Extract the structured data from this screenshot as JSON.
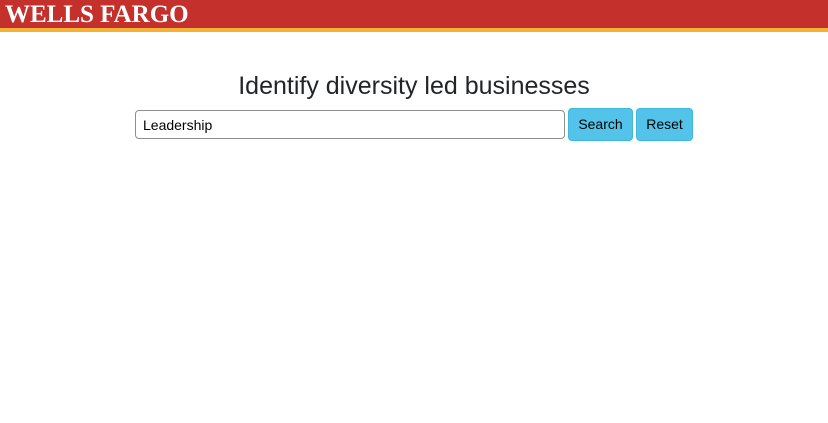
{
  "header": {
    "brand_text": "WELLS FARGO",
    "bar_color": "#c4302b",
    "stripe_color": "#f5b335"
  },
  "main": {
    "title": "Identify diversity led businesses",
    "search": {
      "value": "Leadership",
      "placeholder": ""
    },
    "buttons": {
      "search_label": "Search",
      "reset_label": "Reset",
      "color": "#54c3ea"
    }
  }
}
